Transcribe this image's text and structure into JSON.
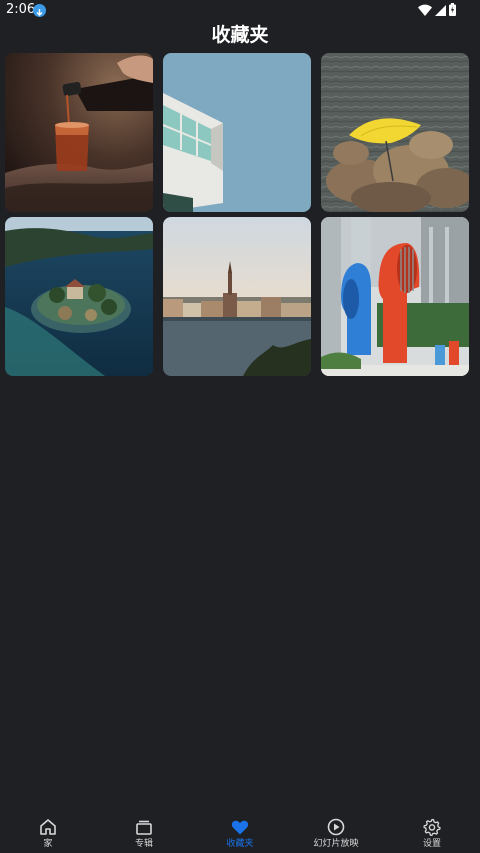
{
  "status_bar": {
    "time": "2:06",
    "download_icon": "download-circle-icon",
    "wifi_icon": "wifi-icon",
    "signal_icon": "cell-signal-icon",
    "battery_icon": "battery-icon"
  },
  "header": {
    "title": "收藏夹"
  },
  "gallery": {
    "items": [
      {
        "subject": "pouring-drink-photo"
      },
      {
        "subject": "building-balcony-photo"
      },
      {
        "subject": "yellow-umbrella-rocks-photo"
      },
      {
        "subject": "island-in-lake-photo"
      },
      {
        "subject": "city-waterfront-photo"
      },
      {
        "subject": "colorful-vent-pipes-photo"
      }
    ]
  },
  "bottom_nav": {
    "active_color": "#1a73e8",
    "items": [
      {
        "label": "家",
        "icon": "home-icon"
      },
      {
        "label": "专辑",
        "icon": "album-icon"
      },
      {
        "label": "收藏夹",
        "icon": "heart-icon",
        "active": true
      },
      {
        "label": "幻灯片放映",
        "icon": "play-circle-icon"
      },
      {
        "label": "设置",
        "icon": "gear-icon"
      }
    ]
  }
}
